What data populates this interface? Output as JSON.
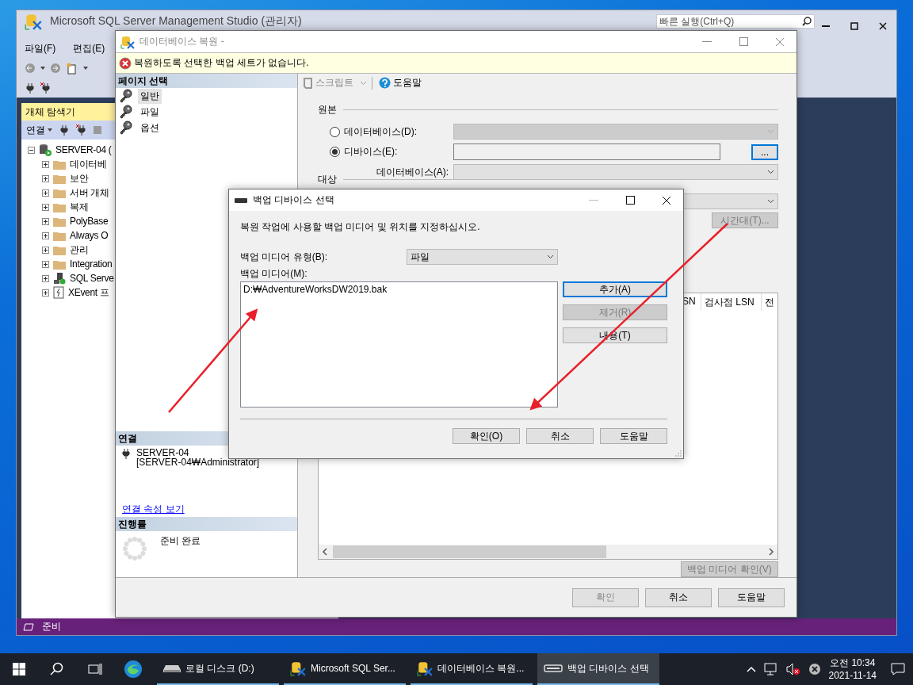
{
  "ssms": {
    "title": "Microsoft SQL Server Management Studio (관리자)",
    "quick_launch": {
      "placeholder": "빠른 실행(Ctrl+Q)"
    },
    "menu": [
      "파일(F)",
      "편집(E)"
    ],
    "object_explorer": {
      "title": "개체 탐색기",
      "connect": "연결",
      "tree": [
        {
          "label": "SERVER-04 (",
          "kind": "server",
          "expanded": true,
          "children": [
            {
              "label": "데이터베",
              "kind": "folder",
              "expanded": false
            },
            {
              "label": "보안",
              "kind": "folder",
              "expanded": false
            },
            {
              "label": "서버 개체",
              "kind": "folder",
              "expanded": false
            },
            {
              "label": "복제",
              "kind": "folder",
              "expanded": false
            },
            {
              "label": "PolyBase",
              "kind": "folder",
              "expanded": false
            },
            {
              "label": "Always O",
              "kind": "folder",
              "expanded": false
            },
            {
              "label": "관리",
              "kind": "folder",
              "expanded": false
            },
            {
              "label": "Integration",
              "kind": "folder",
              "expanded": false
            },
            {
              "label": "SQL Serve",
              "kind": "agent",
              "expanded": false
            },
            {
              "label": "XEvent 프",
              "kind": "xevent",
              "expanded": false
            }
          ]
        }
      ]
    },
    "status": "준비"
  },
  "restore_dialog": {
    "title": "데이터베이스 복원 -",
    "message": "복원하도록 선택한 백업 세트가 없습니다.",
    "pages_header": "페이지 선택",
    "pages": [
      {
        "label": "일반",
        "selected": true
      },
      {
        "label": "파일",
        "selected": false
      },
      {
        "label": "옵션",
        "selected": false
      }
    ],
    "toolbar": {
      "script": "스크립트",
      "help": "도움말"
    },
    "source": {
      "title": "원본",
      "options": [
        {
          "label": "데이터베이스(D):",
          "selected": false
        },
        {
          "label": "디바이스(E):",
          "selected": true
        }
      ],
      "browse_button": "...",
      "database_label": "데이터베이스(A):"
    },
    "destination": {
      "title": "대상",
      "timeline_button": "시간대(T)..."
    },
    "grid": {
      "columns": [
        "SN",
        "검사점 LSN",
        "전"
      ]
    },
    "verify_button": "백업 미디어 확인(V)",
    "connection_header": "연결",
    "server": "SERVER-04",
    "user": "[SERVER-04₩Administrator]",
    "connection_link": "연결 속성 보기",
    "progress_header": "진행률",
    "progress_status": "준비 완료",
    "buttons": [
      {
        "label": "확인",
        "disabled": true
      },
      {
        "label": "취소",
        "disabled": false
      },
      {
        "label": "도움말",
        "disabled": false
      }
    ]
  },
  "device_dialog": {
    "title": "백업 디바이스 선택",
    "description": "복원 작업에 사용할 백업 미디어 및 위치를 지정하십시오.",
    "media_type_label": "백업 미디어 유형(B):",
    "media_type": "파일",
    "media_label": "백업 미디어(M):",
    "media": [
      "D:₩AdventureWorksDW2019.bak"
    ],
    "side_buttons": [
      {
        "label": "추가(A)",
        "disabled": false,
        "focused": true
      },
      {
        "label": "제거(R)",
        "disabled": true,
        "focused": false
      },
      {
        "label": "내용(T)",
        "disabled": false,
        "focused": false
      }
    ],
    "buttons": [
      "확인(O)",
      "취소",
      "도움말"
    ]
  },
  "taskbar": {
    "items": [
      {
        "label": "로컬 디스크 (D:)",
        "kind": "drive",
        "selected": false
      },
      {
        "label": "Microsoft SQL Ser...",
        "kind": "ssms",
        "selected": false
      },
      {
        "label": "데이터베이스 복원...",
        "kind": "ssms",
        "selected": false
      },
      {
        "label": "백업 디바이스 선택",
        "kind": "device",
        "selected": true
      }
    ],
    "time": "오전 10:34",
    "date": "2021-11-14"
  }
}
